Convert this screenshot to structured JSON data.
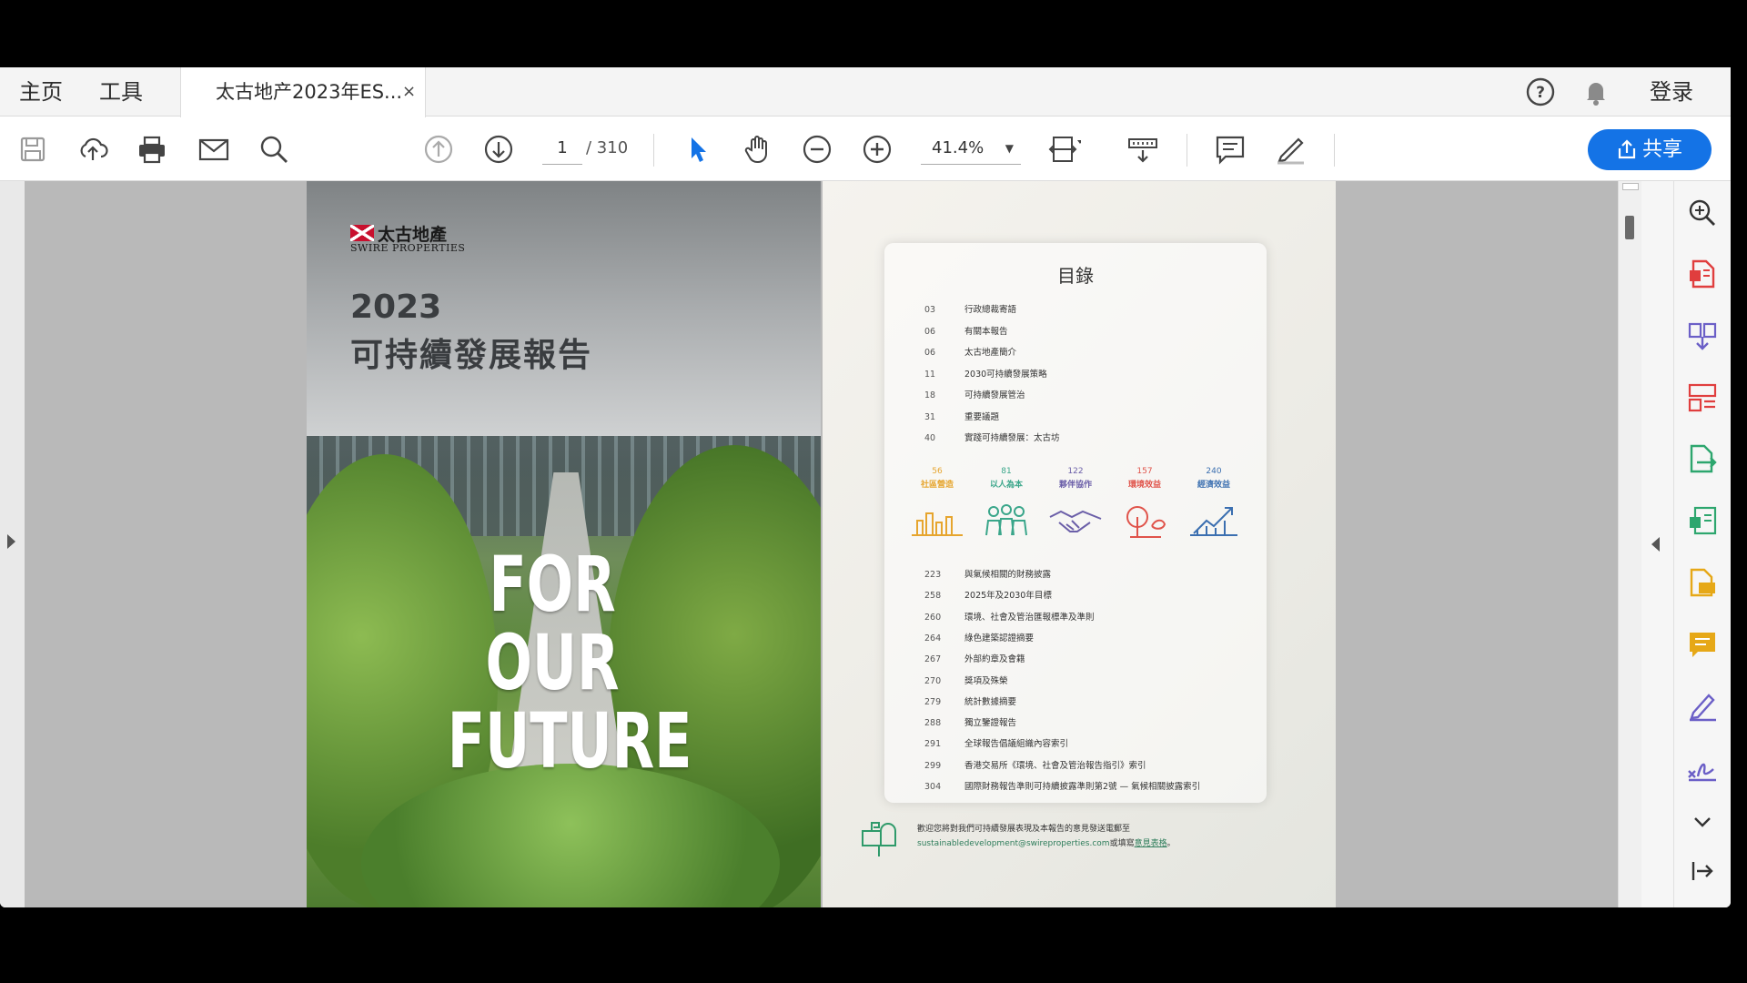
{
  "menu": {
    "home": "主页",
    "tools": "工具"
  },
  "tab": {
    "title": "太古地产2023年ES...",
    "close": "×"
  },
  "header_right": {
    "login": "登录",
    "help_icon": "help-circle-icon",
    "bell_icon": "bell-icon"
  },
  "toolbar": {
    "page_current": "1",
    "page_total": "/ 310",
    "zoom": "41.4%",
    "share_label": "共享"
  },
  "colors": {
    "accent": "#1473e6",
    "rail_red": "#e03e3e",
    "rail_purple": "#6b5fc7",
    "rail_green": "#2da66e",
    "rail_yellow": "#e6a817"
  },
  "cover": {
    "logo_cn": "太古地產",
    "logo_en": "SWIRE PROPERTIES",
    "year": "2023",
    "title": "可持續發展報告",
    "slogan_1": "FOR",
    "slogan_2": "OUR",
    "slogan_3": "FUTURE"
  },
  "toc": {
    "heading": "目錄",
    "top_entries": [
      {
        "page": "03",
        "title": "行政總裁寄語"
      },
      {
        "page": "06",
        "title": "有關本報告"
      },
      {
        "page": "06",
        "title": "太古地產簡介"
      },
      {
        "page": "11",
        "title": "2030可持續發展策略"
      },
      {
        "page": "18",
        "title": "可持續發展管治"
      },
      {
        "page": "31",
        "title": "重要議題"
      },
      {
        "page": "40",
        "title": "實踐可持續發展：太古坊"
      }
    ],
    "pillars": [
      {
        "page": "56",
        "label": "社區營造",
        "color": "#e6a52e"
      },
      {
        "page": "81",
        "label": "以人為本",
        "color": "#3aa68a"
      },
      {
        "page": "122",
        "label": "夥伴協作",
        "color": "#6b5fa8"
      },
      {
        "page": "157",
        "label": "環境效益",
        "color": "#e0534a"
      },
      {
        "page": "240",
        "label": "經濟效益",
        "color": "#3b6fb0"
      }
    ],
    "bottom_entries": [
      {
        "page": "223",
        "title": "與氣候相關的財務披露"
      },
      {
        "page": "258",
        "title": "2025年及2030年目標"
      },
      {
        "page": "260",
        "title": "環境、社會及管治匯報標準及準則"
      },
      {
        "page": "264",
        "title": "綠色建築認證摘要"
      },
      {
        "page": "267",
        "title": "外部約章及會籍"
      },
      {
        "page": "270",
        "title": "獎項及殊榮"
      },
      {
        "page": "279",
        "title": "統計數據摘要"
      },
      {
        "page": "288",
        "title": "獨立鑒證報告"
      },
      {
        "page": "291",
        "title": "全球報告倡議組織內容索引"
      },
      {
        "page": "299",
        "title": "香港交易所《環境、社會及管治報告指引》索引"
      },
      {
        "page": "304",
        "title": "國際財務報告準則可持續披露準則第2號 — 氣候相關披露索引"
      }
    ],
    "feedback_line1": "歡迎您將對我們可持續發展表現及本報告的意見發送電郵至",
    "feedback_email": "sustainabledevelopment@swireproperties.com",
    "feedback_mid": "或填寫",
    "feedback_link": "意見表格",
    "feedback_end": "。"
  }
}
